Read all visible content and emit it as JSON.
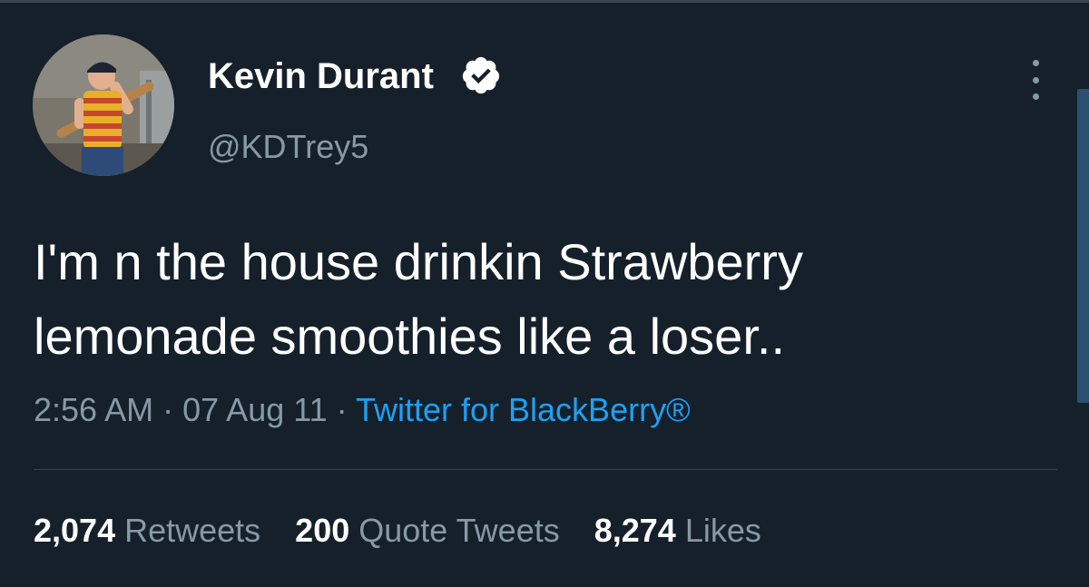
{
  "user": {
    "display_name": "Kevin Durant",
    "handle": "@KDTrey5",
    "verified_icon": "verified-badge-icon"
  },
  "tweet": {
    "text": "I'm n the house drinkin Strawberry lemonade smoothies like a loser..",
    "time": "2:56 AM",
    "date": "07 Aug 11",
    "separator": "·",
    "source": "Twitter for BlackBerry®"
  },
  "stats": {
    "retweets_count": "2,074",
    "retweets_label": "Retweets",
    "quotes_count": "200",
    "quotes_label": "Quote Tweets",
    "likes_count": "8,274",
    "likes_label": "Likes"
  },
  "colors": {
    "background": "#15202b",
    "primary_text": "#ffffff",
    "secondary_text": "#8899a6",
    "accent": "#1da1f2",
    "divider": "#38444d"
  },
  "icons": {
    "more": "more-vertical-icon"
  }
}
